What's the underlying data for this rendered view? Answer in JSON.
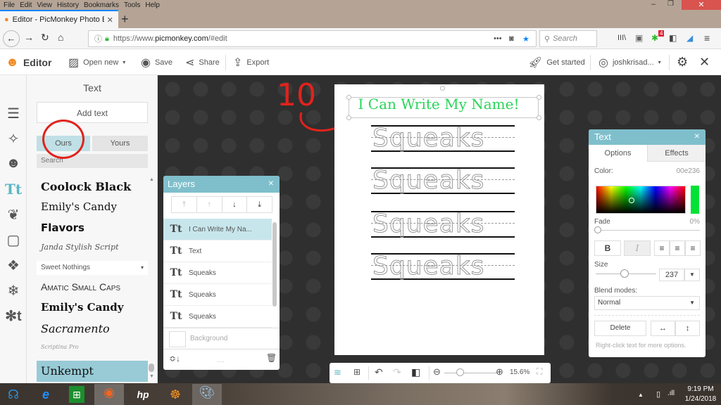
{
  "browser": {
    "menu": [
      "File",
      "Edit",
      "View",
      "History",
      "Bookmarks",
      "Tools",
      "Help"
    ],
    "tab_title": "Editor - PicMonkey Photo Edito",
    "url_prefix": "https://www.",
    "url_domain": "picmonkey.com",
    "url_suffix": "/#edit",
    "search_placeholder": "Search",
    "notification_count": "4"
  },
  "app": {
    "brand": "Editor",
    "open_new": "Open new",
    "save": "Save",
    "share": "Share",
    "export": "Export",
    "get_started": "Get started",
    "user": "joshkrisad..."
  },
  "text_panel": {
    "title": "Text",
    "add_text": "Add text",
    "tab_ours": "Ours",
    "tab_yours": "Yours",
    "search_placeholder": "Search",
    "fonts": [
      "Coolock Black",
      "Emily's Candy",
      "Flavors",
      "Janda Stylish Script",
      "Sweet Nothings",
      "Amatic Small Caps",
      "Emily's Candy",
      "Sacramento",
      "Scriptina Pro",
      "Unkempt"
    ]
  },
  "annotation": {
    "number": "10"
  },
  "canvas": {
    "title": "I Can Write My Name!",
    "title_color": "#00e236",
    "practice_words": [
      "Squeaks",
      "Squeaks",
      "Squeaks",
      "Squeaks"
    ]
  },
  "layers": {
    "title": "Layers",
    "items": [
      "I Can Write My Na...",
      "Text",
      "Squeaks",
      "Squeaks",
      "Squeaks"
    ],
    "background": "Background"
  },
  "text_options": {
    "title": "Text",
    "tab_options": "Options",
    "tab_effects": "Effects",
    "color_label": "Color:",
    "color_value": "00e236",
    "fade_label": "Fade",
    "fade_value": "0%",
    "bold": "B",
    "italic": "I",
    "size_label": "Size",
    "size_value": "237",
    "blend_label": "Blend modes:",
    "blend_value": "Normal",
    "delete": "Delete",
    "hint": "Right-click text for more options."
  },
  "bottom_bar": {
    "zoom": "15.6%"
  },
  "taskbar": {
    "time": "9:19 PM",
    "date": "1/24/2018"
  }
}
